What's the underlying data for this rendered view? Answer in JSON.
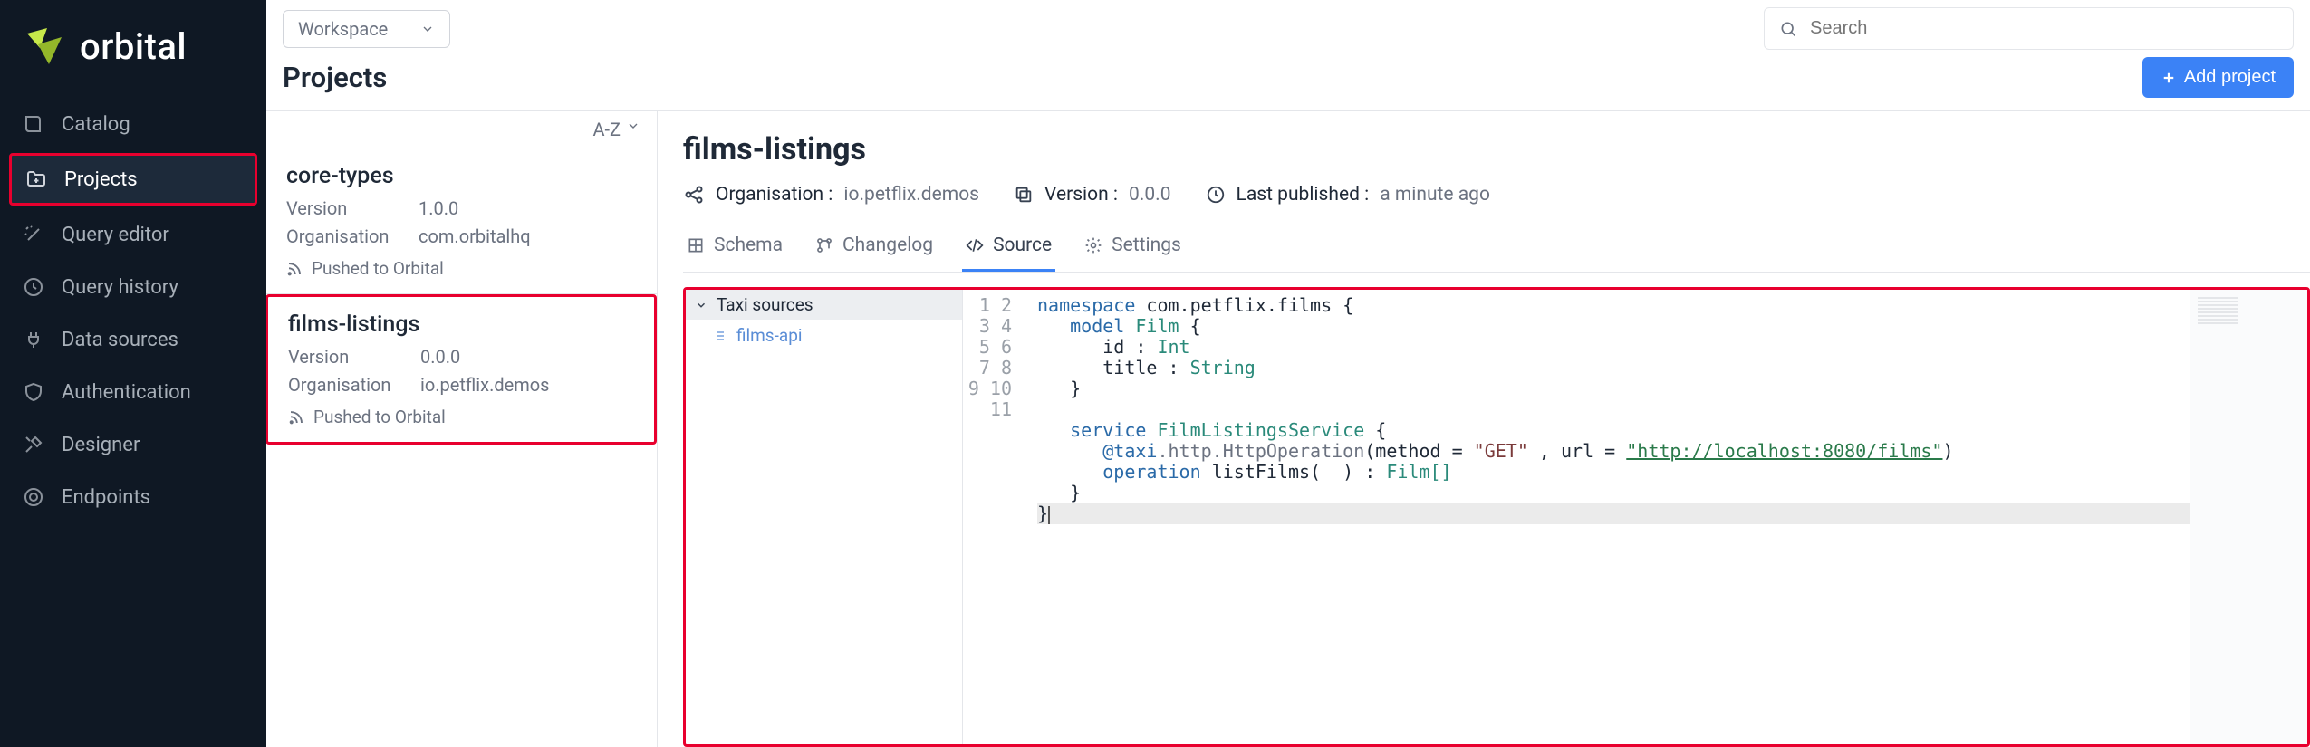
{
  "brand": "orbital",
  "topbar": {
    "workspace": "Workspace",
    "search_placeholder": "Search"
  },
  "header": {
    "page_title": "Projects",
    "add_button": "Add project"
  },
  "sidebar": {
    "items": [
      {
        "label": "Catalog"
      },
      {
        "label": "Projects"
      },
      {
        "label": "Query editor"
      },
      {
        "label": "Query history"
      },
      {
        "label": "Data sources"
      },
      {
        "label": "Authentication"
      },
      {
        "label": "Designer"
      },
      {
        "label": "Endpoints"
      }
    ],
    "active_index": 1,
    "highlight_index": 1
  },
  "project_list": {
    "sort_label": "A-Z",
    "version_key": "Version",
    "org_key": "Organisation",
    "items": [
      {
        "name": "core-types",
        "version": "1.0.0",
        "org": "com.orbitalhq",
        "status": "Pushed to Orbital"
      },
      {
        "name": "films-listings",
        "version": "0.0.0",
        "org": "io.petflix.demos",
        "status": "Pushed to Orbital"
      }
    ],
    "highlight_index": 1
  },
  "detail": {
    "title": "films-listings",
    "meta": {
      "org_label": "Organisation :",
      "org_value": "io.petflix.demos",
      "version_label": "Version :",
      "version_value": "0.0.0",
      "published_label": "Last published :",
      "published_value": "a minute ago"
    },
    "tabs": [
      {
        "label": "Schema"
      },
      {
        "label": "Changelog"
      },
      {
        "label": "Source"
      },
      {
        "label": "Settings"
      }
    ],
    "active_tab": 2
  },
  "tree": {
    "header": "Taxi sources",
    "items": [
      {
        "label": "films-api"
      }
    ]
  },
  "code": {
    "lines": 11,
    "tokens": {
      "namespace": "namespace",
      "ns_value": "com.petflix.films",
      "model": "model",
      "model_name": "Film",
      "id": "id",
      "int": "Int",
      "title": "title",
      "string": "String",
      "service": "service",
      "service_name": "FilmListingsService",
      "ann_decorator": "@taxi",
      "ann_path": ".http.HttpOperation",
      "method_key": "method",
      "method_val": "\"GET\"",
      "url_key": "url",
      "url_val": "\"http://localhost:8080/films\"",
      "operation": "operation",
      "op_name": "listFilms",
      "film_arr": "Film[]"
    }
  }
}
